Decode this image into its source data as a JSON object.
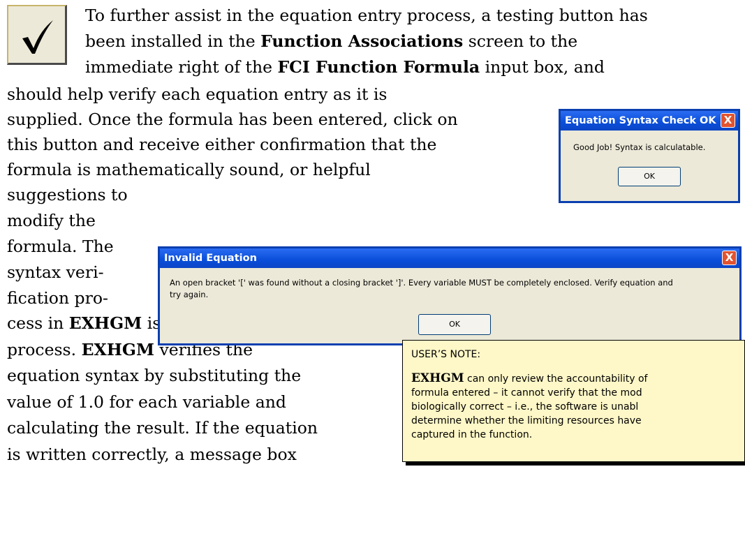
{
  "intro_lines": [
    {
      "parts": [
        {
          "t": "To further assist in the equation entry process, a testing button has"
        }
      ]
    },
    {
      "parts": [
        {
          "t": "been installed in the "
        },
        {
          "t": "Function Associations",
          "b": true
        },
        {
          "t": " screen to the"
        }
      ]
    },
    {
      "parts": [
        {
          "t": "immediate right of the "
        },
        {
          "t": "FCI Function Formula",
          "b": true
        },
        {
          "t": " input box, and"
        }
      ]
    }
  ],
  "middle_lines": [
    "should help verify each equation entry as it is",
    "supplied. Once the formula has been entered, click on",
    "this button and receive either confirmation that the",
    "formula is mathematically sound, or helpful"
  ],
  "narrow_lines": [
    "suggestions to",
    "modify the",
    "formula. The",
    "syntax veri-",
    "fication pro-"
  ],
  "lower_lines": [
    {
      "parts": [
        {
          "t": "cess in "
        },
        {
          "t": "EXHGM",
          "b": true
        },
        {
          "t": " is a substitution"
        }
      ]
    },
    {
      "parts": [
        {
          "t": "process. "
        },
        {
          "t": "EXHGM",
          "b": true
        },
        {
          "t": " verifies the"
        }
      ]
    },
    {
      "parts": [
        {
          "t": "equation syntax by substituting the"
        }
      ]
    },
    {
      "parts": [
        {
          "t": "value of 1.0 for each variable and"
        }
      ]
    },
    {
      "parts": [
        {
          "t": "calculating the result. If the equation"
        }
      ]
    },
    {
      "parts": [
        {
          "t": "is written correctly, a message box"
        }
      ]
    }
  ],
  "syntax_ok_dialog": {
    "title": "Equation Syntax Check OK",
    "close": "X",
    "message": "Good Job!  Syntax is calculatable.",
    "ok_label": "OK"
  },
  "invalid_dialog": {
    "title": "Invalid Equation",
    "close": "X",
    "message_line1": "An open bracket '[' was found without a closing bracket ']'. Every variable MUST be completely enclosed. Verify equation and",
    "message_line2": "try again.",
    "ok_label": "OK"
  },
  "note": {
    "heading": "USER’S NOTE:",
    "body_bold": "EXHGM",
    "body_line1_rest": " can only review the accountability of",
    "body_lines": [
      "formula entered – it cannot verify that the mod",
      "biologically correct – i.e., the software is unabl",
      "determine whether the limiting resources have",
      "captured in the function."
    ]
  },
  "colors": {
    "dialog_title_blue": "#0a4ed9",
    "close_red": "#e2532f",
    "note_background": "#fef7c7"
  }
}
